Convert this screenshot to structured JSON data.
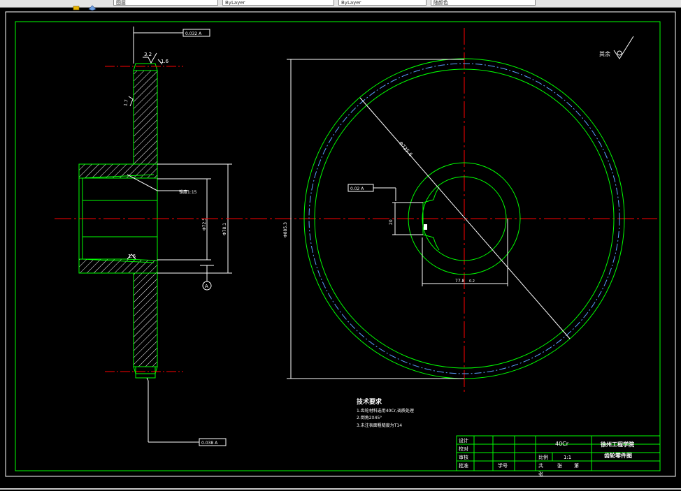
{
  "toolbar": {
    "field1": "图层",
    "field2": "ByLayer",
    "field3": "ByLayer",
    "field4": "ByLayer",
    "field5": "随颜色",
    "colors": {
      "bg": "#e4e4e4",
      "field": "#ffffff"
    }
  },
  "drawing": {
    "colors": {
      "background": "#000000",
      "outline": "#00ff00",
      "centerline": "#ff0000",
      "dimension": "#ffffff",
      "pitch_circle": "#5aa0ff"
    },
    "section_view": {
      "top_tolerance": "0.032 A",
      "bottom_tolerance": "0.038 A",
      "chamfer_top_left": "3.2",
      "chamfer_top_right": "1.6",
      "side_roughness": "1.7",
      "bore_roughness": "1.6",
      "taper_note": "锥度1:15",
      "dim_inner": "Φ72.5",
      "dim_outer": "Φ78.1",
      "datum_label": "A"
    },
    "front_view": {
      "tip_dia": "Φ885.3",
      "pitch_dia_label": "Φ725.6",
      "bore_tolerance": "0.02 A",
      "keyway_width": "20",
      "keyway_depth": "77.8",
      "keyway_depth_suffix": "0.2",
      "roughness_note": "其余",
      "roughness_value": "12.5"
    },
    "technical_requirements": {
      "title": "技术要求",
      "items": [
        "1.齿轮材料选用40Cr,调质处理",
        "2.倒角2X45°",
        "3.未注表面粗糙度为T14"
      ]
    },
    "title_block": {
      "rows": [
        "设计",
        "校对",
        "审核",
        "批准"
      ],
      "student_label": "学号",
      "material": "40Cr",
      "scale_label": "比例",
      "scale_value": "1:1",
      "sheets_label_a": "共",
      "sheets_label_b": "张",
      "sheets_label_c": "第",
      "sheets_label_d": "张",
      "school": "徐州工程学院",
      "drawing_name": "齿轮零件图"
    }
  }
}
